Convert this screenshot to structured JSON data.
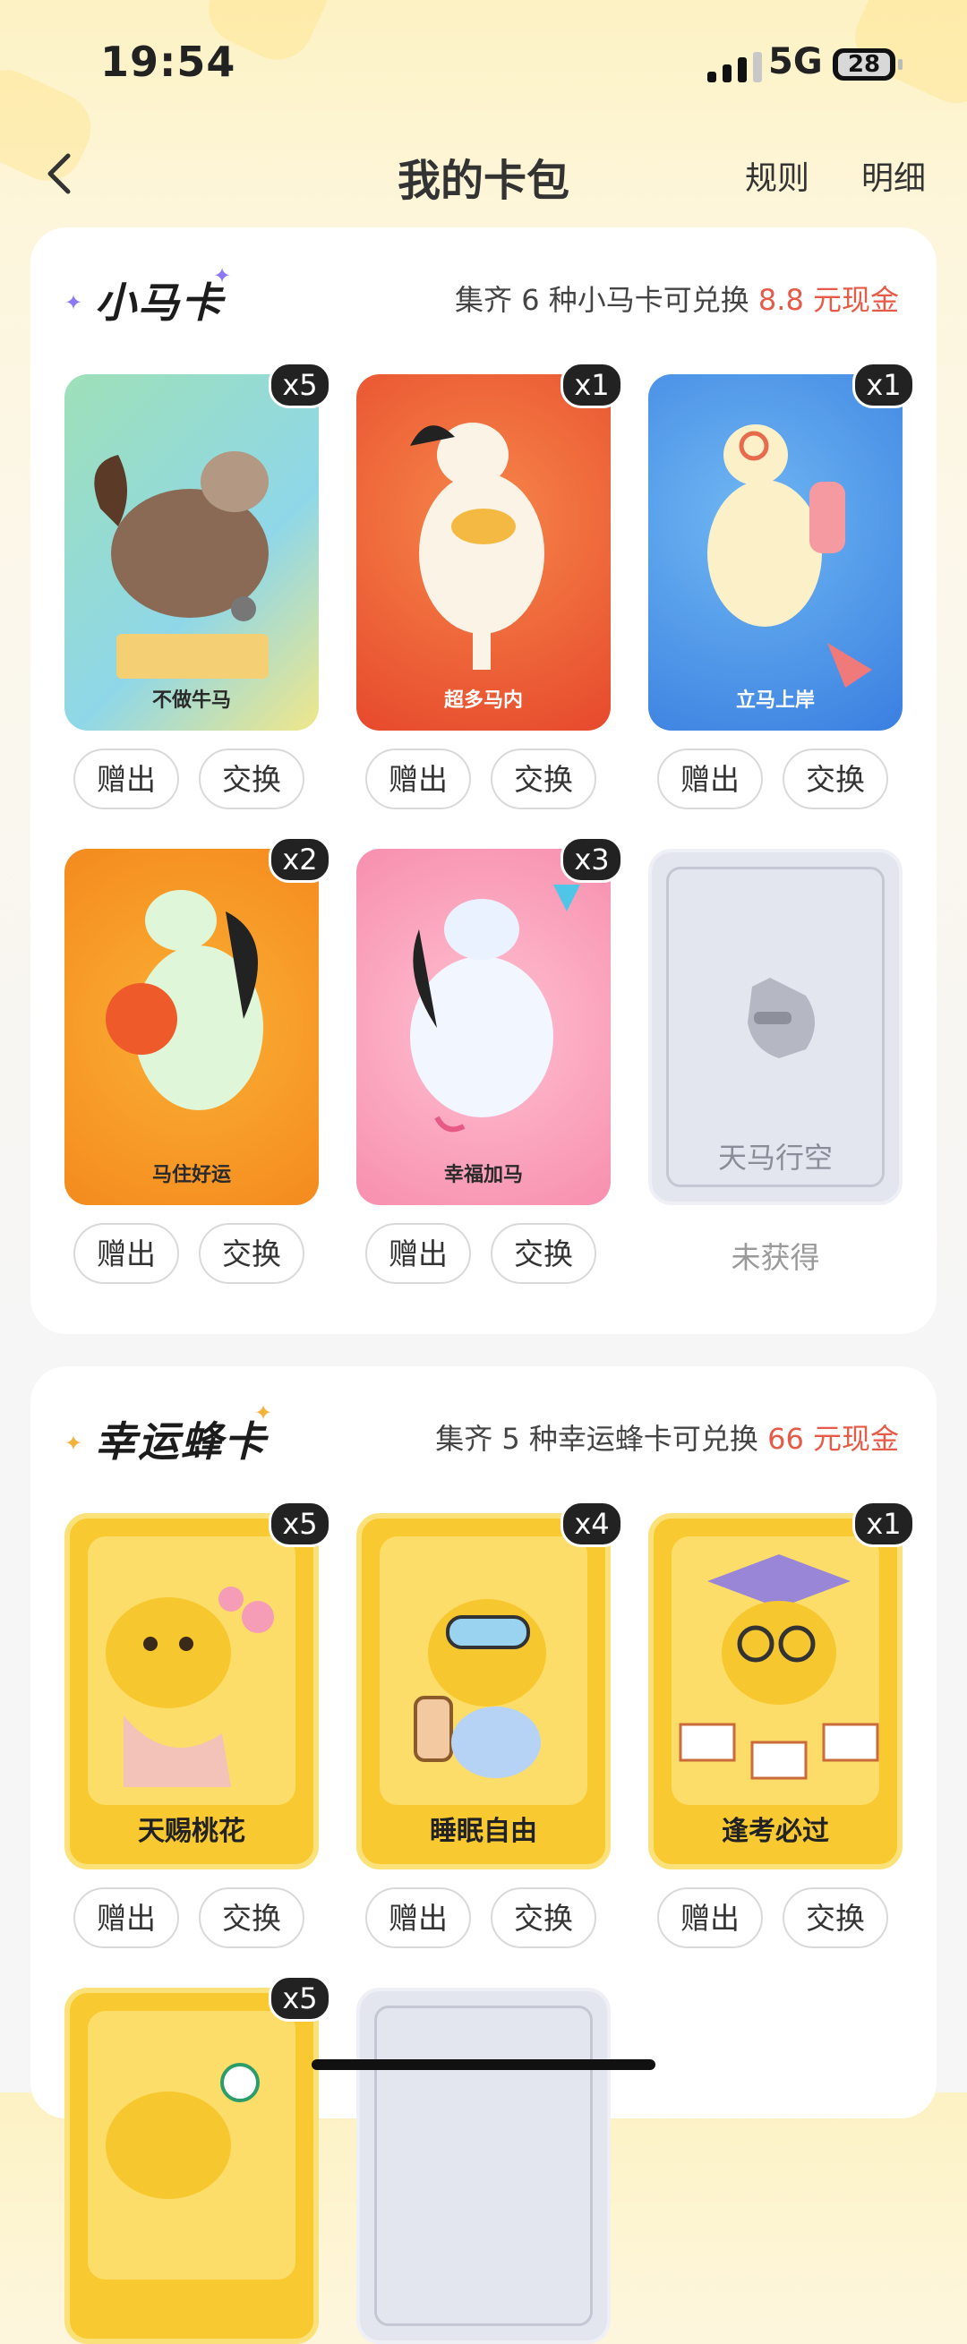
{
  "status_bar": {
    "time": "19:54",
    "network": "5G",
    "battery": "28"
  },
  "nav": {
    "title": "我的卡包",
    "rules": "规则",
    "details": "明细"
  },
  "horse_section": {
    "title": "小马卡",
    "desc_prefix": "集齐 6 种小马卡可兑换 ",
    "desc_highlight": "8.8 元现金",
    "gift_label": "赠出",
    "exchange_label": "交换",
    "unobtained_label": "未获得",
    "cards": [
      {
        "name": "不做牛马",
        "count": "x5"
      },
      {
        "name": "超多马内",
        "count": "x1"
      },
      {
        "name": "立马上岸",
        "count": "x1"
      },
      {
        "name": "马住好运",
        "count": "x2"
      },
      {
        "name": "幸福加马",
        "count": "x3"
      },
      {
        "name": "天马行空",
        "count": ""
      }
    ]
  },
  "bee_section": {
    "title": "幸运蜂卡",
    "desc_prefix": "集齐 5 种幸运蜂卡可兑换 ",
    "desc_highlight": "66 元现金",
    "gift_label": "赠出",
    "exchange_label": "交换",
    "cards": [
      {
        "name": "天赐桃花",
        "count": "x5"
      },
      {
        "name": "睡眠自由",
        "count": "x4"
      },
      {
        "name": "逢考必过",
        "count": "x1"
      },
      {
        "name": "",
        "count": "x5"
      }
    ]
  },
  "colors": {
    "accent_red": "#e65a48",
    "background": "#fdf2c4"
  }
}
